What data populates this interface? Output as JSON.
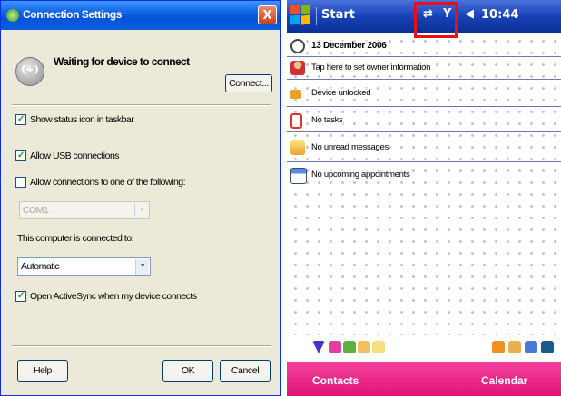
{
  "dialog": {
    "title": "Connection Settings",
    "close_glyph": "X",
    "status": "Waiting for device to connect",
    "connect_label": "Connect...",
    "checkboxes": [
      {
        "label": "Show status icon in taskbar",
        "checked": true
      },
      {
        "label": "Allow USB connections",
        "checked": true
      },
      {
        "label": "Allow connections to one of the following:",
        "checked": false
      }
    ],
    "port_select": "COM1",
    "connected_to_label": "This computer is connected to:",
    "connected_to_value": "Automatic",
    "open_activesync": {
      "label": "Open ActiveSync when my device connects",
      "checked": true
    },
    "help_label": "Help",
    "ok_label": "OK",
    "cancel_label": "Cancel"
  },
  "device": {
    "start_label": "Start",
    "time": "10:44",
    "date": "13 December 2006",
    "rows": [
      {
        "icon": "clock-icon",
        "text": "13 December 2006"
      },
      {
        "icon": "owner-icon",
        "text": "Tap here to set owner information"
      },
      {
        "icon": "lock-icon",
        "text": "Device unlocked"
      },
      {
        "icon": "tasks-icon",
        "text": "No tasks"
      },
      {
        "icon": "inbox-icon",
        "text": "No unread messages"
      },
      {
        "icon": "calendar-icon",
        "text": "No upcoming appointments"
      }
    ],
    "softkey_left": "Contacts",
    "softkey_right": "Calendar",
    "colors": {
      "softkey_bar": "#e0157a",
      "highlight": "#e8101a"
    }
  }
}
